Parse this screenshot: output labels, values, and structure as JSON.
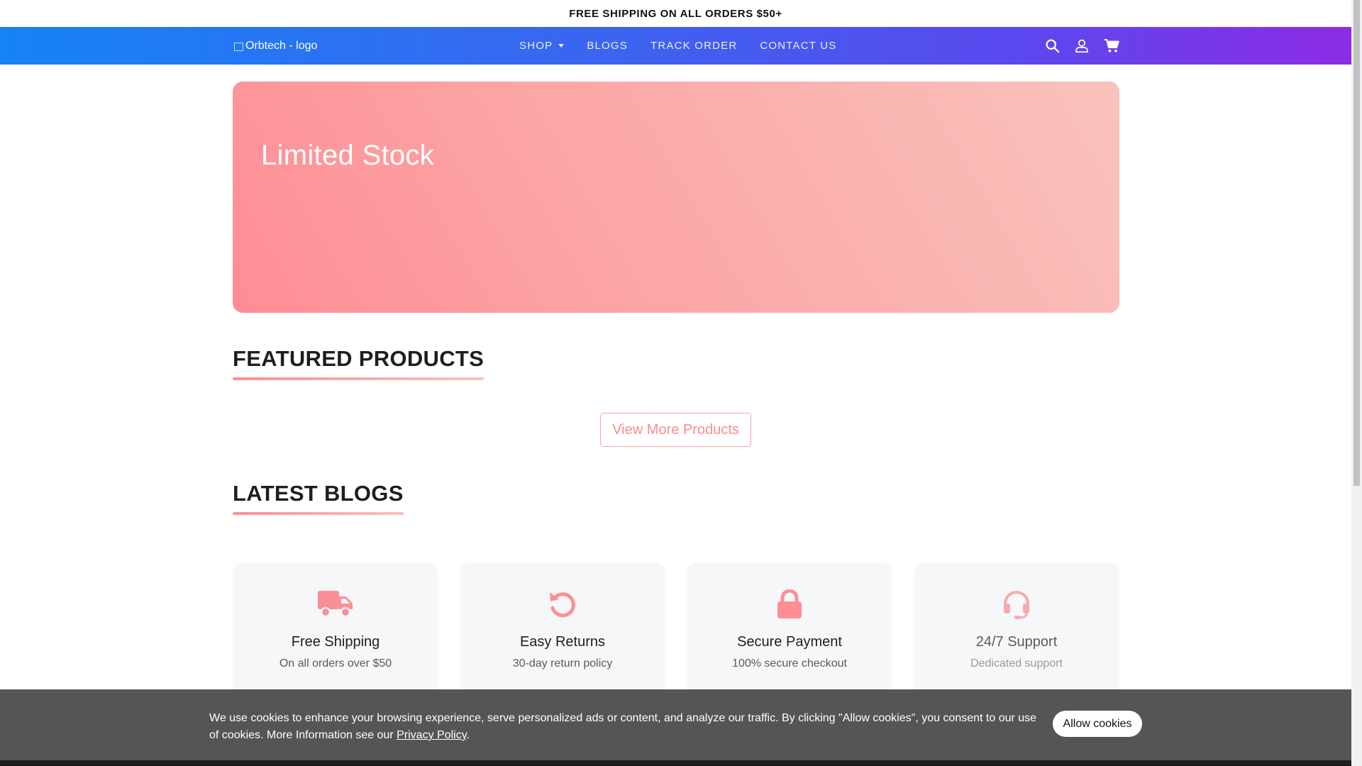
{
  "announcement": {
    "text": "FREE SHIPPING ON ALL ORDERS $50+"
  },
  "navbar": {
    "logo_alt": "Orbtech - logo",
    "links": [
      {
        "label": "SHOP",
        "has_dropdown": true
      },
      {
        "label": "BLOGS"
      },
      {
        "label": "TRACK ORDER"
      },
      {
        "label": "CONTACT US"
      }
    ],
    "icons": [
      "search-icon",
      "user-icon",
      "cart-icon"
    ]
  },
  "hero": {
    "title": "Limited Stock"
  },
  "sections": {
    "featured": {
      "title": "FEATURED PRODUCTS",
      "button": "View More Products"
    },
    "blogs": {
      "title": "LATEST BLOGS"
    }
  },
  "features": [
    {
      "icon": "truck-icon",
      "title": "Free Shipping",
      "subtitle": "On all orders over $50"
    },
    {
      "icon": "returns-icon",
      "title": "Easy Returns",
      "subtitle": "30-day return policy"
    },
    {
      "icon": "lock-icon",
      "title": "Secure Payment",
      "subtitle": "100% secure checkout"
    },
    {
      "icon": "headset-icon",
      "title": "24/7 Support",
      "subtitle": "Dedicated support"
    }
  ],
  "cookie": {
    "text": "We use cookies to enhance your browsing experience, serve personalized ads or content, and analyze our traffic. By clicking \"Allow cookies\", you consent to our use of cookies. More Information see our ",
    "link": "Privacy Policy",
    "after_link": ".",
    "button": "Allow cookies"
  },
  "colors": {
    "nav_gradient_start": "#1683f6",
    "nav_gradient_end": "#8d2ce6",
    "accent_pink": "#fa8c92",
    "hero_gradient_start": "#fe8d95",
    "hero_gradient_end": "#f9c2bb"
  }
}
